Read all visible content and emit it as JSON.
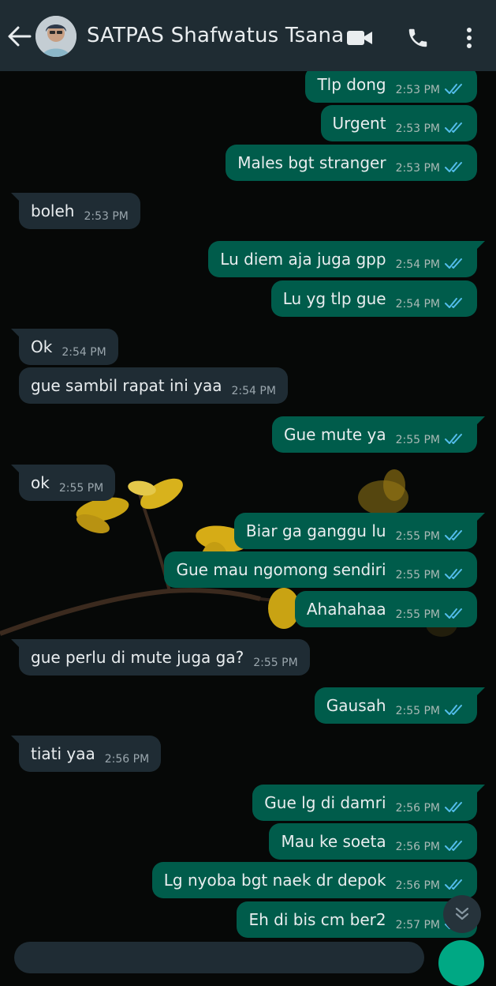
{
  "header": {
    "title": "SATPAS Shafwatus Tsana",
    "back_icon": "arrow-left-icon",
    "video_icon": "video-call-icon",
    "call_icon": "phone-icon",
    "menu_icon": "more-vertical-icon"
  },
  "colors": {
    "header_bg": "#1f2c33",
    "outgoing_bubble": "#005c4b",
    "incoming_bubble": "#1f2c34",
    "read_ticks": "#53bdeb"
  },
  "messages": [
    {
      "dir": "out",
      "text": "Tlp dong",
      "time": "2:53 PM",
      "status": "read",
      "tail": false
    },
    {
      "dir": "out",
      "text": "Urgent",
      "time": "2:53 PM",
      "status": "read",
      "tail": false
    },
    {
      "dir": "out",
      "text": "Males bgt stranger",
      "time": "2:53 PM",
      "status": "read",
      "tail": false
    },
    {
      "dir": "in",
      "text": "boleh",
      "time": "2:53 PM",
      "tail": true
    },
    {
      "dir": "out",
      "text": "Lu diem aja juga gpp",
      "time": "2:54 PM",
      "status": "read",
      "tail": true
    },
    {
      "dir": "out",
      "text": "Lu yg tlp gue",
      "time": "2:54 PM",
      "status": "read",
      "tail": false
    },
    {
      "dir": "in",
      "text": "Ok",
      "time": "2:54 PM",
      "tail": true
    },
    {
      "dir": "in",
      "text": "gue sambil rapat ini yaa",
      "time": "2:54 PM",
      "tail": false
    },
    {
      "dir": "out",
      "text": "Gue mute ya",
      "time": "2:55 PM",
      "status": "read",
      "tail": true
    },
    {
      "dir": "in",
      "text": "ok",
      "time": "2:55 PM",
      "tail": true
    },
    {
      "dir": "out",
      "text": "Biar ga ganggu lu",
      "time": "2:55 PM",
      "status": "read",
      "tail": true
    },
    {
      "dir": "out",
      "text": "Gue mau ngomong sendiri",
      "time": "2:55 PM",
      "status": "read",
      "tail": false
    },
    {
      "dir": "out",
      "text": "Ahahahaa",
      "time": "2:55 PM",
      "status": "read",
      "tail": false
    },
    {
      "dir": "in",
      "text": "gue perlu di mute juga ga?",
      "time": "2:55 PM",
      "tail": true
    },
    {
      "dir": "out",
      "text": "Gausah",
      "time": "2:55 PM",
      "status": "read",
      "tail": true
    },
    {
      "dir": "in",
      "text": "tiati yaa",
      "time": "2:56 PM",
      "tail": true
    },
    {
      "dir": "out",
      "text": "Gue lg di damri",
      "time": "2:56 PM",
      "status": "read",
      "tail": true
    },
    {
      "dir": "out",
      "text": "Mau ke soeta",
      "time": "2:56 PM",
      "status": "read",
      "tail": false
    },
    {
      "dir": "out",
      "text": "Lg nyoba bgt naek dr depok",
      "time": "2:56 PM",
      "status": "read",
      "tail": false
    },
    {
      "dir": "out",
      "text": "Eh di bis cm ber2",
      "time": "2:57 PM",
      "status": "read",
      "tail": false
    }
  ],
  "scroll_button_icon": "double-chevron-down-icon"
}
